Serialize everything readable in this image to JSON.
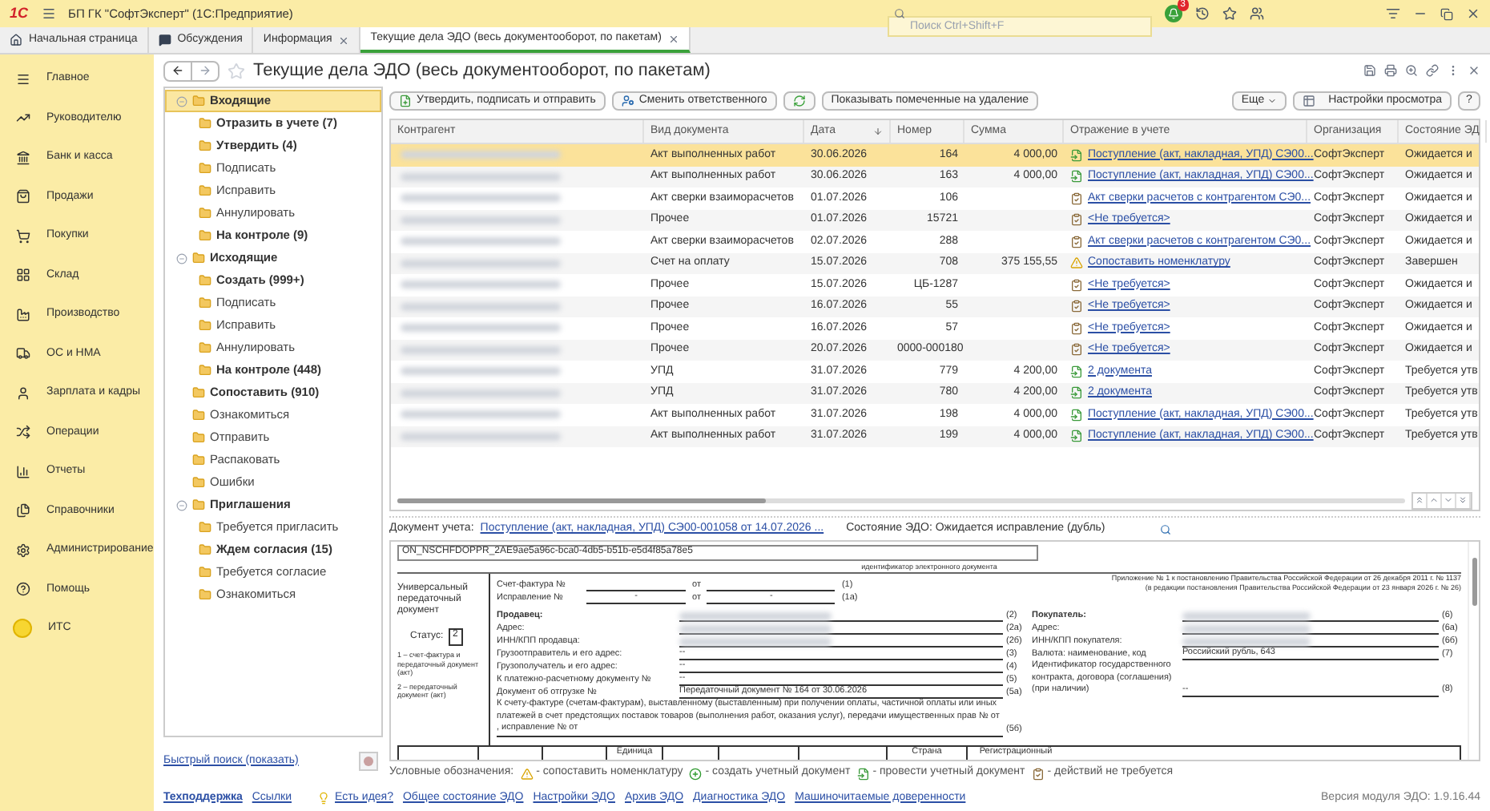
{
  "window": {
    "logo_text": "1С",
    "title": "БП ГК \"СофтЭксперт\" (1С:Предприятие)",
    "search": {
      "placeholder": "Поиск Ctrl+Shift+F"
    },
    "notifications": "3"
  },
  "tabs": [
    {
      "label": "Начальная страница",
      "kind": "home",
      "closable": false,
      "selected": false
    },
    {
      "label": "Обсуждения",
      "kind": "chat",
      "closable": false,
      "selected": false
    },
    {
      "label": "Информация",
      "kind": "page",
      "closable": true,
      "selected": false
    },
    {
      "label": "Текущие дела ЭДО (весь документооборот, по пакетам)",
      "kind": "page",
      "closable": true,
      "selected": true
    }
  ],
  "sidebar": {
    "items": [
      "Главное",
      "Руководителю",
      "Банк и касса",
      "Продажи",
      "Покупки",
      "Склад",
      "Производство",
      "ОС и НМА",
      "Зарплата и кадры",
      "Операции",
      "Отчеты",
      "Справочники",
      "Администрирование",
      "Помощь",
      "ИТС"
    ]
  },
  "page": {
    "title": "Текущие дела ЭДО (весь документооборот, по пакетам)"
  },
  "toolbar": {
    "buttons": [
      {
        "kind": "approve",
        "label": "Утвердить, подписать и отправить"
      },
      {
        "kind": "assign",
        "label": "Сменить ответственного"
      },
      {
        "kind": "refresh"
      },
      {
        "kind": "plain",
        "label": "Показывать помеченные на удаление"
      }
    ],
    "more": "Еще",
    "view_settings": "Настройки просмотра",
    "help": "?"
  },
  "tree": [
    {
      "label": "Входящие",
      "bold": true,
      "selected": true,
      "expanded": true,
      "children": [
        {
          "label": "Отразить в учете (7)",
          "bold": true,
          "selected": false
        },
        {
          "label": "Утвердить (4)",
          "bold": true,
          "selected": false
        },
        {
          "label": "Подписать",
          "bold": false,
          "selected": false
        },
        {
          "label": "Исправить",
          "bold": false,
          "selected": false
        },
        {
          "label": "Аннулировать",
          "bold": false,
          "selected": false
        },
        {
          "label": "На контроле (9)",
          "bold": true,
          "selected": false
        }
      ]
    },
    {
      "label": "Исходящие",
      "bold": true,
      "selected": false,
      "expanded": true,
      "children": [
        {
          "label": "Создать (999+)",
          "bold": true,
          "selected": false
        },
        {
          "label": "Подписать",
          "bold": false,
          "selected": false
        },
        {
          "label": "Исправить",
          "bold": false,
          "selected": false
        },
        {
          "label": "Аннулировать",
          "bold": false,
          "selected": false
        },
        {
          "label": "На контроле (448)",
          "bold": true,
          "selected": false
        }
      ]
    },
    {
      "label": "Сопоставить (910)",
      "bold": true,
      "selected": false
    },
    {
      "label": "Ознакомиться",
      "bold": false,
      "selected": false
    },
    {
      "label": "Отправить",
      "bold": false,
      "selected": false
    },
    {
      "label": "Распаковать",
      "bold": false,
      "selected": false
    },
    {
      "label": "Ошибки",
      "bold": false,
      "selected": false
    },
    {
      "label": "Приглашения",
      "bold": true,
      "selected": false,
      "expanded": true,
      "children": [
        {
          "label": "Требуется пригласить",
          "bold": false,
          "selected": false
        },
        {
          "label": "Ждем согласия (15)",
          "bold": true,
          "selected": false
        },
        {
          "label": "Требуется согласие",
          "bold": false,
          "selected": false
        },
        {
          "label": "Ознакомиться",
          "bold": false,
          "selected": false
        }
      ]
    }
  ],
  "quick_search": "Быстрый поиск (показать)",
  "table": {
    "columns": [
      {
        "label": "Контрагент",
        "sorted": false
      },
      {
        "label": "Вид документа",
        "sorted": false
      },
      {
        "label": "Дата",
        "sorted": true
      },
      {
        "label": "Номер",
        "sorted": false
      },
      {
        "label": "Сумма",
        "sorted": false
      },
      {
        "label": "Отражение в учете",
        "sorted": false
      },
      {
        "label": "Организация",
        "sorted": false
      },
      {
        "label": "Состояние ЭД",
        "sorted": false
      }
    ],
    "rows": [
      {
        "doc_type": "Акт выполненных работ",
        "date": "30.06.2026",
        "number": "164",
        "sum": "4 000,00",
        "kind": "post",
        "reflection": "Поступление (акт, накладная, УПД) СЭ00...",
        "organization": "СофтЭксперт",
        "state": "Ожидается и",
        "selected": true
      },
      {
        "doc_type": "Акт выполненных работ",
        "date": "30.06.2026",
        "number": "163",
        "sum": "4 000,00",
        "kind": "post",
        "reflection": "Поступление (акт, накладная, УПД) СЭ00...",
        "organization": "СофтЭксперт",
        "state": "Ожидается и",
        "selected": false
      },
      {
        "doc_type": "Акт сверки взаиморасчетов",
        "date": "01.07.2026",
        "number": "106",
        "kind": "done",
        "reflection": "Акт сверки расчетов с контрагентом СЭ0...",
        "organization": "СофтЭксперт",
        "state": "Ожидается и",
        "selected": false
      },
      {
        "doc_type": "Прочее",
        "date": "01.07.2026",
        "number": "15721",
        "kind": "done",
        "reflection": "<Не требуется>",
        "organization": "СофтЭксперт",
        "state": "Ожидается и",
        "selected": false
      },
      {
        "doc_type": "Акт сверки взаиморасчетов",
        "date": "02.07.2026",
        "number": "288",
        "kind": "done",
        "reflection": "Акт сверки расчетов с контрагентом СЭ0...",
        "organization": "СофтЭксперт",
        "state": "Ожидается и",
        "selected": false
      },
      {
        "doc_type": "Счет на оплату",
        "date": "15.07.2026",
        "number": "708",
        "sum": "375 155,55",
        "kind": "warning",
        "reflection": "Сопоставить номенклатуру",
        "organization": "СофтЭксперт",
        "state": "Завершен",
        "selected": false
      },
      {
        "doc_type": "Прочее",
        "date": "15.07.2026",
        "number": "ЦБ-1287",
        "kind": "done",
        "reflection": "<Не требуется>",
        "organization": "СофтЭксперт",
        "state": "Ожидается и",
        "selected": false
      },
      {
        "doc_type": "Прочее",
        "date": "16.07.2026",
        "number": "55",
        "kind": "done",
        "reflection": "<Не требуется>",
        "organization": "СофтЭксперт",
        "state": "Ожидается и",
        "selected": false
      },
      {
        "doc_type": "Прочее",
        "date": "16.07.2026",
        "number": "57",
        "kind": "done",
        "reflection": "<Не требуется>",
        "organization": "СофтЭксперт",
        "state": "Ожидается и",
        "selected": false
      },
      {
        "doc_type": "Прочее",
        "date": "20.07.2026",
        "number": "0000-000180",
        "kind": "done",
        "reflection": "<Не требуется>",
        "organization": "СофтЭксперт",
        "state": "Ожидается и",
        "selected": false
      },
      {
        "doc_type": "УПД",
        "date": "31.07.2026",
        "number": "779",
        "sum": "4 200,00",
        "kind": "post",
        "reflection": "2 документа",
        "organization": "СофтЭксперт",
        "state": "Требуется утв",
        "selected": false
      },
      {
        "doc_type": "УПД",
        "date": "31.07.2026",
        "number": "780",
        "sum": "4 200,00",
        "kind": "post",
        "reflection": "2 документа",
        "organization": "СофтЭксперт",
        "state": "Требуется утв",
        "selected": false
      },
      {
        "doc_type": "Акт выполненных работ",
        "date": "31.07.2026",
        "number": "198",
        "sum": "4 000,00",
        "kind": "post",
        "reflection": "Поступление (акт, накладная, УПД) СЭ00...",
        "organization": "СофтЭксперт",
        "state": "Требуется утв",
        "selected": false
      },
      {
        "doc_type": "Акт выполненных работ",
        "date": "31.07.2026",
        "number": "199",
        "sum": "4 000,00",
        "kind": "post",
        "reflection": "Поступление (акт, накладная, УПД) СЭ00...",
        "organization": "СофтЭксперт",
        "state": "Требуется утв",
        "selected": false
      }
    ]
  },
  "document_line": {
    "label": "Документ учета:",
    "link": "Поступление (акт, накладная, УПД) СЭ00-001058 от 14.07.2026 ...",
    "state": "Состояние ЭДО: Ожидается исправление (дубль)"
  },
  "document": {
    "id": "ON_NSCHFDOPPR_2AE9ae5a96c-bca0-4db5-b51b-e5d4f85a78e5",
    "id_caption": "идентификатор электронного документа",
    "type": "Универсальный передаточный документ",
    "status_label": "Статус:",
    "status": "2",
    "status_notes": [
      "1 – счет-фактура и передаточный документ (акт)",
      "2 – передаточный документ (акт)"
    ],
    "appendix": [
      "Приложение № 1 к постановлению Правительства Российской Федерации от 26 декабря 2011 г. № 1137",
      "(в редакции постановления Правительства Российской Федерации от 23 января 2026 г. № 26)"
    ],
    "header_rows": [
      {
        "label": "Счет-фактура №",
        "from": "от",
        "code": "(1)"
      },
      {
        "label": "Исправление №",
        "number": "-",
        "from": "от",
        "date": "-",
        "code": "(1а)"
      }
    ],
    "seller": [
      {
        "label": "Продавец:",
        "bold": true,
        "redacted": true,
        "code": "(2)"
      },
      {
        "label": "Адрес:",
        "bold": false,
        "redacted": true,
        "code": "(2а)"
      },
      {
        "label": "ИНН/КПП продавца:",
        "bold": false,
        "redacted": true,
        "code": "(2б)"
      },
      {
        "label": "Грузоотправитель и его адрес:",
        "bold": false,
        "redacted": false,
        "value": "--",
        "code": "(3)"
      },
      {
        "label": "Грузополучатель и его адрес:",
        "bold": false,
        "redacted": false,
        "value": "--",
        "code": "(4)"
      },
      {
        "label": "К платежно-расчетному документу №",
        "bold": false,
        "redacted": false,
        "value": "--",
        "code": "(5)"
      },
      {
        "label": "Документ об отгрузке №",
        "bold": false,
        "redacted": false,
        "value": "Передаточный документ № 164 от 30.06.2026",
        "code": "(5а)"
      }
    ],
    "advance_note": "К счету-фактуре (счетам-фактурам), выставленному (выставленным) при получении оплаты, частичной оплаты или иных платежей в счет предстоящих поставок товаров (выполнения работ, оказания услуг), передачи имущественных прав № от , исправление № от",
    "advance_code": "(5б)",
    "buyer": [
      {
        "label": "Покупатель:",
        "bold": true,
        "redacted": true,
        "code": "(6)"
      },
      {
        "label": "Адрес:",
        "bold": false,
        "redacted": true,
        "code": "(6а)"
      },
      {
        "label": "ИНН/КПП покупателя:",
        "bold": false,
        "redacted": true,
        "code": "(6б)"
      },
      {
        "label": "Валюта: наименование, код",
        "bold": false,
        "redacted": false,
        "value": "Российский рубль, 643",
        "code": "(7)"
      },
      {
        "label": "Идентификатор государственного контракта, договора (соглашения) (при наличии)",
        "bold": false,
        "redacted": false,
        "value": "--",
        "code": "(8)"
      }
    ],
    "table_headers": [
      "Единица",
      "Страна",
      "Регистрационный"
    ]
  },
  "legend": {
    "title": "Условные обозначения:",
    "items": [
      {
        "kind": "warning",
        "label": "- сопоставить номенклатуру"
      },
      {
        "kind": "create",
        "label": "- создать учетный документ"
      },
      {
        "kind": "post",
        "label": "- провести учетный документ"
      },
      {
        "kind": "done",
        "label": "- действий не требуется"
      }
    ]
  },
  "footer": {
    "links": [
      {
        "kind": "bold",
        "label": "Техподдержка"
      },
      {
        "kind": "plain",
        "label": "Ссылки"
      },
      {
        "kind": "idea",
        "label": "Есть идея?"
      },
      {
        "kind": "plain",
        "label": "Общее состояние ЭДО"
      },
      {
        "kind": "plain",
        "label": "Настройки ЭДО"
      },
      {
        "kind": "plain",
        "label": "Архив ЭДО"
      },
      {
        "kind": "plain",
        "label": "Диагностика ЭДО"
      },
      {
        "kind": "plain",
        "label": "Машиночитаемые доверенности"
      }
    ],
    "version": "Версия модуля ЭДО: 1.9.16.44"
  }
}
